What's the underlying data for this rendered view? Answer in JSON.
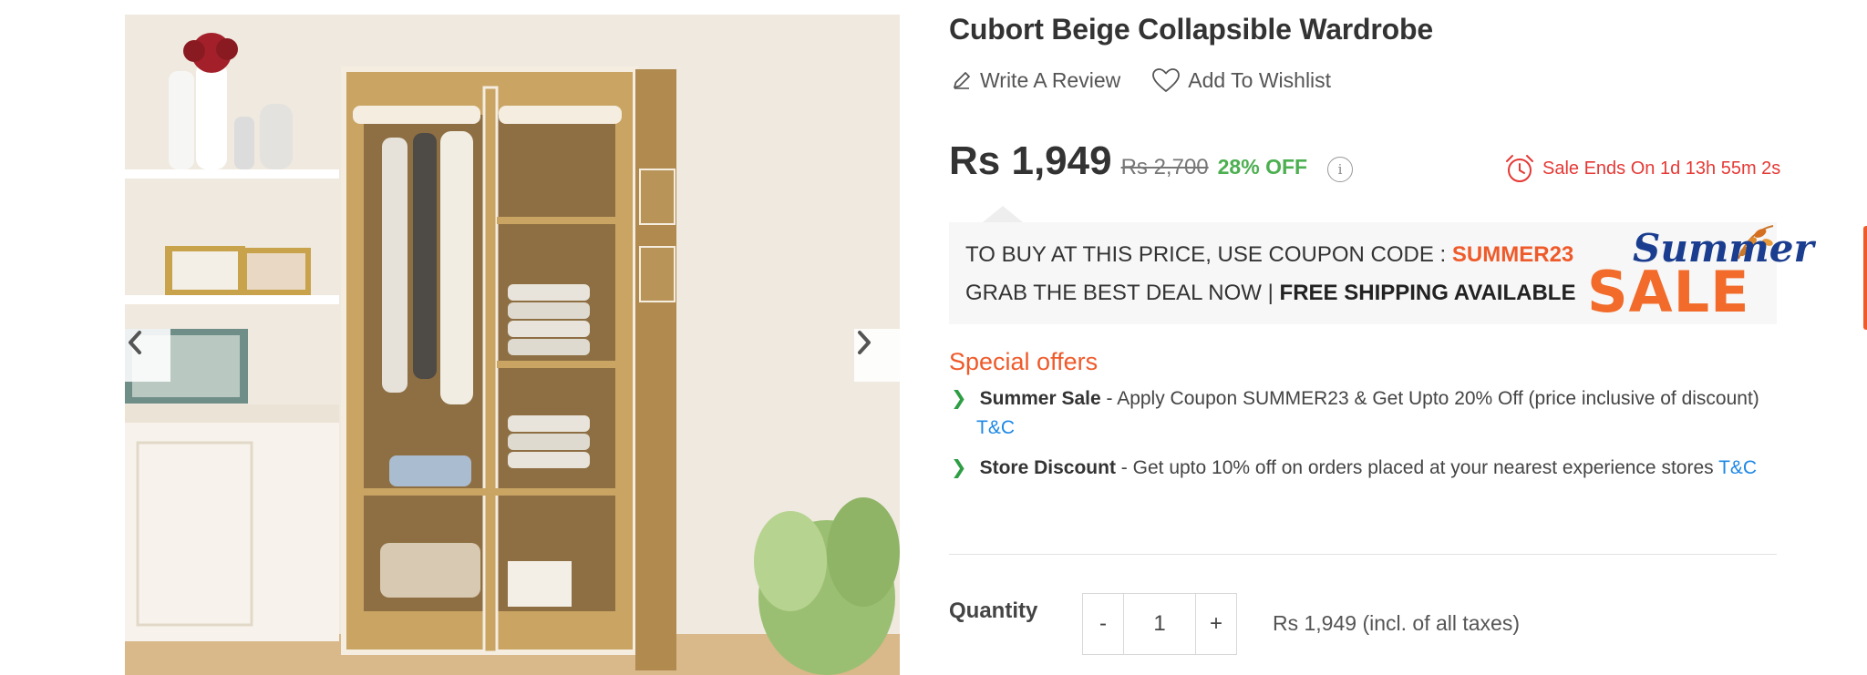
{
  "product": {
    "title": "Cubort Beige Collapsible Wardrobe",
    "write_review": "Write A Review",
    "add_wishlist": "Add To Wishlist",
    "price": "Rs 1,949",
    "mrp": "Rs 2,700",
    "discount": "28% OFF",
    "info": "i",
    "sale_ends": "Sale Ends On 1d 13h 55m 2s"
  },
  "banner": {
    "line1_prefix": "TO BUY AT THIS PRICE, USE COUPON CODE :",
    "coupon_code": "SUMMER23",
    "line2_prefix": "GRAB THE BEST DEAL NOW |",
    "line2_bold": "FREE SHIPPING AVAILABLE",
    "logo_word1": "Summer",
    "logo_word2": "SALE"
  },
  "offers": {
    "title": "Special offers",
    "items": [
      {
        "name": "Summer Sale",
        "text": " - Apply Coupon SUMMER23 & Get Upto 20% Off (price inclusive of discount)",
        "link": "T&C"
      },
      {
        "name": "Store Discount",
        "text": " - Get upto 10% off on orders placed at your nearest experience stores ",
        "link": "T&C"
      }
    ],
    "bullet": "❯"
  },
  "quantity": {
    "label": "Quantity",
    "minus": "-",
    "value": "1",
    "plus": "+",
    "total": "Rs 1,949 (incl. of all taxes)"
  },
  "colors": {
    "accent_orange": "#ef5a2a",
    "discount_green": "#4caf50",
    "sale_red": "#e53935",
    "link_blue": "#1e88e5",
    "wardrobe_beige": "#c9a463"
  },
  "icons": {
    "review": "pencil-icon",
    "wishlist": "heart-icon",
    "sale_timer": "alarm-clock-icon",
    "gallery_prev": "chevron-left-icon",
    "gallery_next": "chevron-right-icon"
  }
}
